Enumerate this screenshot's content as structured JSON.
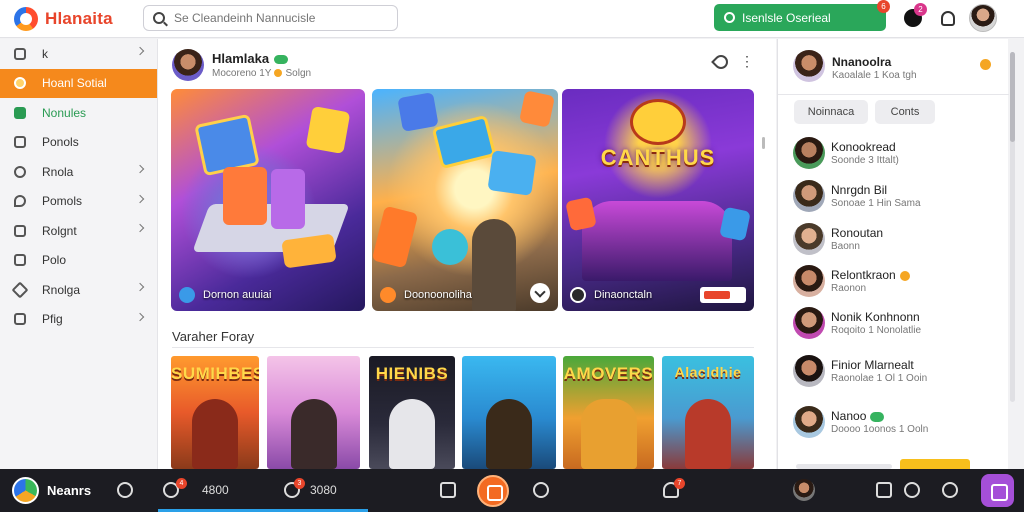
{
  "app": {
    "title": "Hlanaita"
  },
  "search": {
    "placeholder": "Se Cleandeinh Nannucisle"
  },
  "header": {
    "cta_label": "Isenlsle Oserieal",
    "cta_badge": "6",
    "notif_badge": "2"
  },
  "sidebar": {
    "items": [
      {
        "label": "k",
        "icon": "trend-icon",
        "chevron": true
      },
      {
        "label": "Hoanl Sotial",
        "icon": "social-icon",
        "active": true
      },
      {
        "label": "Nonules",
        "icon": "modules-icon",
        "green": true
      },
      {
        "label": "Ponols",
        "icon": "folder-icon"
      },
      {
        "label": "Rnola",
        "icon": "circle-icon",
        "chevron": true
      },
      {
        "label": "Pomols",
        "icon": "drop-icon",
        "chevron": true
      },
      {
        "label": "Rolgnt",
        "icon": "box-icon",
        "chevron": true
      },
      {
        "label": "Polo",
        "icon": "page-icon"
      },
      {
        "label": "Rnolga",
        "icon": "diamond-icon",
        "chevron": true
      },
      {
        "label": "Pfig",
        "icon": "grid-icon",
        "chevron": true
      }
    ]
  },
  "post": {
    "author": "Hlamlaka",
    "meta_left": "Mocoreno 1Y",
    "meta_right": "Solgn",
    "cards": [
      {
        "label": "Dornon auuiai"
      },
      {
        "label": "Doonoonoliha"
      },
      {
        "label": "Dinaonctaln",
        "art_title": "CANTHUS"
      }
    ]
  },
  "section": {
    "title": "Varaher Foray",
    "thumbs": [
      "SUMIHBES",
      "",
      "HIENIBS",
      "",
      "AMOVERS",
      "Alacldhie"
    ]
  },
  "right": {
    "profile": {
      "name": "Nnanoolra",
      "sub": "Kaoalale 1 Koa tgh"
    },
    "tabs": [
      "Noinnaca",
      "Conts"
    ],
    "contacts": [
      {
        "name": "Konookread",
        "sub": "Soonde 3 Ittalt)",
        "badge": ""
      },
      {
        "name": "Nnrgdn Bil",
        "sub": "Sonoae 1 Hin Sama",
        "badge": ""
      },
      {
        "name": "Ronoutan",
        "sub": "Baonn",
        "badge": ""
      },
      {
        "name": "Relontkraon",
        "sub": "Raonon",
        "badge": "orange"
      },
      {
        "name": "Nonik Konhnonn",
        "sub": "Roqoito 1 Nonolatlie",
        "badge": ""
      },
      {
        "name": "Finior Mlarnealt",
        "sub": "Raonolae 1 Ol 1 Ooin",
        "badge": ""
      },
      {
        "name": "Nanoo",
        "sub": "Doooo 1oonos 1 Ooln",
        "badge": "green"
      }
    ]
  },
  "bottombar": {
    "name": "Neanrs",
    "likes": "4800",
    "likes_badge": "4",
    "views": "3080",
    "views_badge": "3",
    "alerts_badge": "7"
  }
}
